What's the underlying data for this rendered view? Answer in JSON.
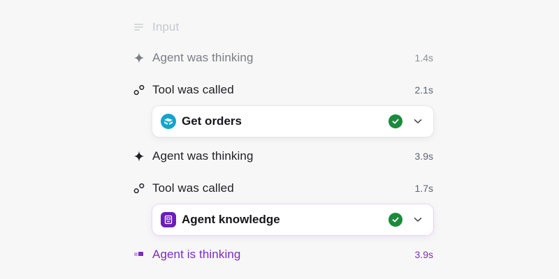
{
  "steps": [
    {
      "label": "Input",
      "time": "",
      "icon": "lines-icon",
      "state": "faded"
    },
    {
      "label": "Agent was thinking",
      "time": "1.4s",
      "icon": "sparkle-icon",
      "state": "muted"
    },
    {
      "label": "Tool was called",
      "time": "2.1s",
      "icon": "tool-link-icon",
      "state": "normal",
      "tool": {
        "name": "Get orders",
        "icon": "orders-icon",
        "status": "success",
        "expanded": false
      }
    },
    {
      "label": "Agent was thinking",
      "time": "3.9s",
      "icon": "sparkle-icon",
      "state": "normal"
    },
    {
      "label": "Tool was called",
      "time": "1.7s",
      "icon": "tool-link-icon",
      "state": "normal",
      "tool": {
        "name": "Agent knowledge",
        "icon": "knowledge-icon",
        "status": "success",
        "expanded": false
      }
    },
    {
      "label": "Agent is thinking",
      "time": "3.9s",
      "icon": "progress-icon",
      "state": "active"
    }
  ],
  "colors": {
    "accent_purple": "#7b2cbf",
    "success_green": "#1a8a3c",
    "orders_teal": "#14a3cf",
    "knowledge_violet": "#6a1fb8"
  }
}
